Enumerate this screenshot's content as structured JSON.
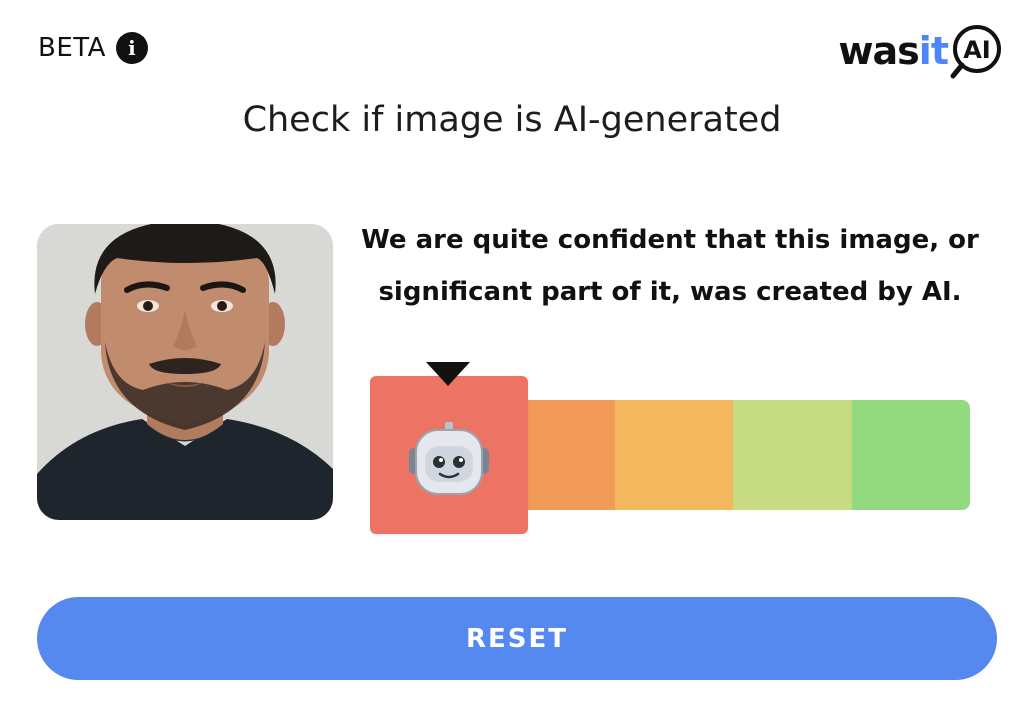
{
  "header": {
    "beta_label": "BETA",
    "info_icon": "info-icon",
    "logo": {
      "text_was": "was",
      "text_it": "it",
      "badge_text": "AI",
      "accent": "#4f86f7"
    }
  },
  "main": {
    "title": "Check if image is AI-generated",
    "result_line1": "We are quite confident that this image, or",
    "result_line2": "significant part of it, was created by AI.",
    "uploaded_image": "uploaded-portrait-photo",
    "verdict_icon": "robot-icon",
    "scale": {
      "selected_index": 0,
      "segment_colors": [
        "#ed7364",
        "#f29a57",
        "#f3b85e",
        "#c6db82",
        "#93d97f"
      ]
    }
  },
  "actions": {
    "reset_label": "RESET",
    "reset_color": "#5589f0"
  }
}
